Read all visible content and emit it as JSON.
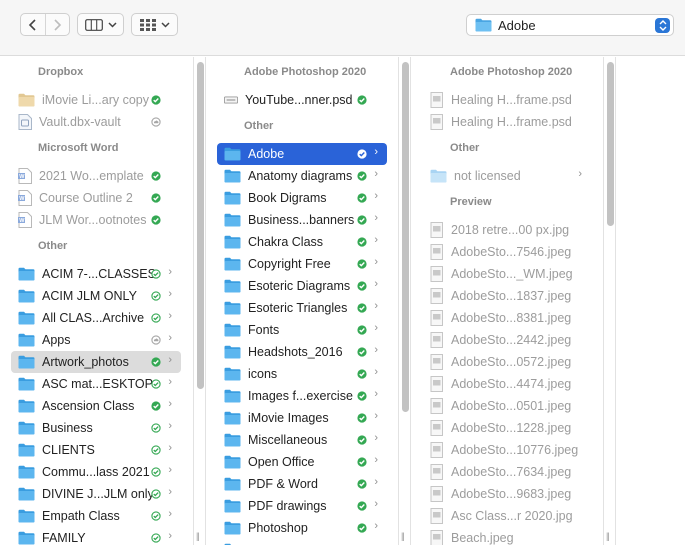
{
  "toolbar": {
    "back_icon": "chevron-left-icon",
    "forward_icon": "chevron-right-icon",
    "view_icon": "columns-view-icon",
    "group_icon": "grid-group-icon",
    "path_label": "Adobe",
    "accent_color": "#2a63d8"
  },
  "col1": {
    "sections": [
      {
        "header": "Dropbox",
        "items": [
          {
            "name": "iMovie Li...ary copy",
            "icon": "folder-tan",
            "status": "synced",
            "dim": true
          },
          {
            "name": "Vault.dbx-vault",
            "icon": "doc",
            "status": "cloud",
            "dim": true
          }
        ]
      },
      {
        "header": "Microsoft Word",
        "items": [
          {
            "name": "2021 Wo...emplate",
            "icon": "word",
            "status": "synced",
            "dim": true
          },
          {
            "name": "Course Outline 2",
            "icon": "word",
            "status": "synced",
            "dim": true
          },
          {
            "name": "JLM Wor...ootnotes",
            "icon": "word",
            "status": "synced",
            "dim": true
          }
        ]
      },
      {
        "header": "Other",
        "items": [
          {
            "name": "ACIM 7-...CLASSES",
            "icon": "folder",
            "status": "synced-outline",
            "chevron": true
          },
          {
            "name": "ACIM JLM ONLY",
            "icon": "folder",
            "status": "synced-outline",
            "chevron": true
          },
          {
            "name": "All CLAS...Archive",
            "icon": "folder",
            "status": "synced-outline",
            "chevron": true
          },
          {
            "name": "Apps",
            "icon": "folder",
            "status": "cloud",
            "chevron": true
          },
          {
            "name": "Artwork_photos",
            "icon": "folder",
            "status": "synced",
            "chevron": true,
            "selected": "gray"
          },
          {
            "name": "ASC mat...ESKTOP",
            "icon": "folder",
            "status": "synced-outline",
            "chevron": true
          },
          {
            "name": "Ascension Class",
            "icon": "folder",
            "status": "synced",
            "chevron": true
          },
          {
            "name": "Business",
            "icon": "folder",
            "status": "synced-outline",
            "chevron": true
          },
          {
            "name": "CLIENTS",
            "icon": "folder",
            "status": "synced-outline",
            "chevron": true
          },
          {
            "name": "Commu...lass 2021",
            "icon": "folder",
            "status": "synced-outline",
            "chevron": true
          },
          {
            "name": "DIVINE J...JLM only",
            "icon": "folder",
            "status": "synced-outline",
            "chevron": true
          },
          {
            "name": "Empath Class",
            "icon": "folder",
            "status": "synced-outline",
            "chevron": true
          },
          {
            "name": "FAMILY",
            "icon": "folder",
            "status": "synced-outline",
            "chevron": true
          }
        ]
      }
    ]
  },
  "col2": {
    "sections": [
      {
        "header": "Adobe Photoshop 2020",
        "items": [
          {
            "name": "YouTube...nner.psd",
            "icon": "psd",
            "status": "synced"
          }
        ]
      },
      {
        "header": "Other",
        "items": [
          {
            "name": "Adobe",
            "icon": "folder",
            "status": "synced",
            "chevron": true,
            "selected": "blue"
          },
          {
            "name": "Anatomy diagrams",
            "icon": "folder",
            "status": "synced",
            "chevron": true
          },
          {
            "name": "Book Digrams",
            "icon": "folder",
            "status": "synced",
            "chevron": true
          },
          {
            "name": "Business...banners",
            "icon": "folder",
            "status": "synced",
            "chevron": true
          },
          {
            "name": "Chakra Class",
            "icon": "folder",
            "status": "synced",
            "chevron": true
          },
          {
            "name": "Copyright Free",
            "icon": "folder",
            "status": "synced",
            "chevron": true
          },
          {
            "name": "Esoteric Diagrams",
            "icon": "folder",
            "status": "synced",
            "chevron": true
          },
          {
            "name": "Esoteric Triangles",
            "icon": "folder",
            "status": "synced",
            "chevron": true
          },
          {
            "name": "Fonts",
            "icon": "folder",
            "status": "synced",
            "chevron": true
          },
          {
            "name": "Headshots_2016",
            "icon": "folder",
            "status": "synced",
            "chevron": true
          },
          {
            "name": "icons",
            "icon": "folder",
            "status": "synced",
            "chevron": true
          },
          {
            "name": "Images f...exercise",
            "icon": "folder",
            "status": "synced",
            "chevron": true
          },
          {
            "name": "iMovie Images",
            "icon": "folder",
            "status": "synced",
            "chevron": true
          },
          {
            "name": "Miscellaneous",
            "icon": "folder",
            "status": "synced",
            "chevron": true
          },
          {
            "name": "Open Office",
            "icon": "folder",
            "status": "synced",
            "chevron": true
          },
          {
            "name": "PDF & Word",
            "icon": "folder",
            "status": "synced",
            "chevron": true
          },
          {
            "name": "PDF drawings",
            "icon": "folder",
            "status": "synced",
            "chevron": true
          },
          {
            "name": "Photoshop",
            "icon": "folder",
            "status": "synced",
            "chevron": true
          },
          {
            "name": "",
            "icon": "folder",
            "status": "synced",
            "chevron": true
          }
        ]
      }
    ]
  },
  "col3": {
    "sections": [
      {
        "header": "Adobe Photoshop 2020",
        "items": [
          {
            "name": "Healing H...frame.psd",
            "icon": "img",
            "dim": true
          },
          {
            "name": "Healing H...frame.psd",
            "icon": "img",
            "dim": true
          }
        ]
      },
      {
        "header": "Other",
        "items": [
          {
            "name": "not licensed",
            "icon": "folder-light",
            "chevron": true,
            "dim": true
          }
        ]
      },
      {
        "header": "Preview",
        "items": [
          {
            "name": "2018 retre...00 px.jpg",
            "icon": "img",
            "dim": true
          },
          {
            "name": "AdobeSto...7546.jpeg",
            "icon": "img",
            "dim": true
          },
          {
            "name": "AdobeSto..._WM.jpeg",
            "icon": "img",
            "dim": true
          },
          {
            "name": "AdobeSto...1837.jpeg",
            "icon": "img",
            "dim": true
          },
          {
            "name": "AdobeSto...8381.jpeg",
            "icon": "img",
            "dim": true
          },
          {
            "name": "AdobeSto...2442.jpeg",
            "icon": "img",
            "dim": true
          },
          {
            "name": "AdobeSto...0572.jpeg",
            "icon": "img",
            "dim": true
          },
          {
            "name": "AdobeSto...4474.jpeg",
            "icon": "img",
            "dim": true
          },
          {
            "name": "AdobeSto...0501.jpeg",
            "icon": "img",
            "dim": true
          },
          {
            "name": "AdobeSto...1228.jpeg",
            "icon": "img",
            "dim": true
          },
          {
            "name": "AdobeSto...10776.jpeg",
            "icon": "img",
            "dim": true
          },
          {
            "name": "AdobeSto...7634.jpeg",
            "icon": "img",
            "dim": true
          },
          {
            "name": "AdobeSto...9683.jpeg",
            "icon": "img",
            "dim": true
          },
          {
            "name": "Asc Class...r 2020.jpg",
            "icon": "img",
            "dim": true
          },
          {
            "name": "Beach.jpeg",
            "icon": "img",
            "dim": true
          }
        ]
      }
    ]
  }
}
